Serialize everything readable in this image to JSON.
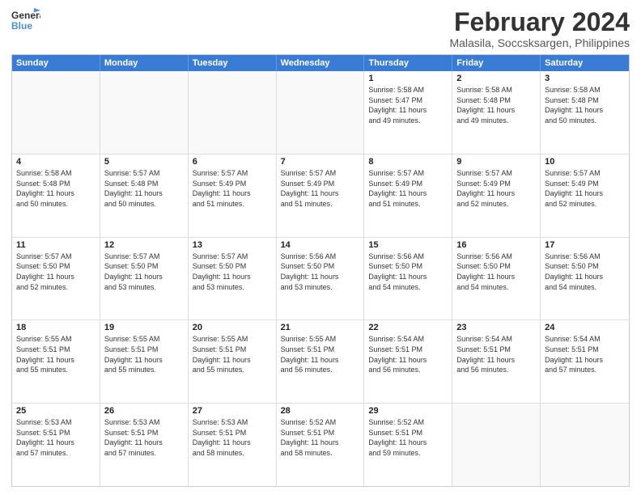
{
  "header": {
    "logo_line1": "General",
    "logo_line2": "Blue",
    "month": "February 2024",
    "location": "Malasila, Soccsksargen, Philippines"
  },
  "weekdays": [
    "Sunday",
    "Monday",
    "Tuesday",
    "Wednesday",
    "Thursday",
    "Friday",
    "Saturday"
  ],
  "rows": [
    [
      {
        "day": "",
        "info": "",
        "empty": true
      },
      {
        "day": "",
        "info": "",
        "empty": true
      },
      {
        "day": "",
        "info": "",
        "empty": true
      },
      {
        "day": "",
        "info": "",
        "empty": true
      },
      {
        "day": "1",
        "info": "Sunrise: 5:58 AM\nSunset: 5:47 PM\nDaylight: 11 hours\nand 49 minutes.",
        "empty": false
      },
      {
        "day": "2",
        "info": "Sunrise: 5:58 AM\nSunset: 5:48 PM\nDaylight: 11 hours\nand 49 minutes.",
        "empty": false
      },
      {
        "day": "3",
        "info": "Sunrise: 5:58 AM\nSunset: 5:48 PM\nDaylight: 11 hours\nand 50 minutes.",
        "empty": false
      }
    ],
    [
      {
        "day": "4",
        "info": "Sunrise: 5:58 AM\nSunset: 5:48 PM\nDaylight: 11 hours\nand 50 minutes.",
        "empty": false
      },
      {
        "day": "5",
        "info": "Sunrise: 5:57 AM\nSunset: 5:48 PM\nDaylight: 11 hours\nand 50 minutes.",
        "empty": false
      },
      {
        "day": "6",
        "info": "Sunrise: 5:57 AM\nSunset: 5:49 PM\nDaylight: 11 hours\nand 51 minutes.",
        "empty": false
      },
      {
        "day": "7",
        "info": "Sunrise: 5:57 AM\nSunset: 5:49 PM\nDaylight: 11 hours\nand 51 minutes.",
        "empty": false
      },
      {
        "day": "8",
        "info": "Sunrise: 5:57 AM\nSunset: 5:49 PM\nDaylight: 11 hours\nand 51 minutes.",
        "empty": false
      },
      {
        "day": "9",
        "info": "Sunrise: 5:57 AM\nSunset: 5:49 PM\nDaylight: 11 hours\nand 52 minutes.",
        "empty": false
      },
      {
        "day": "10",
        "info": "Sunrise: 5:57 AM\nSunset: 5:49 PM\nDaylight: 11 hours\nand 52 minutes.",
        "empty": false
      }
    ],
    [
      {
        "day": "11",
        "info": "Sunrise: 5:57 AM\nSunset: 5:50 PM\nDaylight: 11 hours\nand 52 minutes.",
        "empty": false
      },
      {
        "day": "12",
        "info": "Sunrise: 5:57 AM\nSunset: 5:50 PM\nDaylight: 11 hours\nand 53 minutes.",
        "empty": false
      },
      {
        "day": "13",
        "info": "Sunrise: 5:57 AM\nSunset: 5:50 PM\nDaylight: 11 hours\nand 53 minutes.",
        "empty": false
      },
      {
        "day": "14",
        "info": "Sunrise: 5:56 AM\nSunset: 5:50 PM\nDaylight: 11 hours\nand 53 minutes.",
        "empty": false
      },
      {
        "day": "15",
        "info": "Sunrise: 5:56 AM\nSunset: 5:50 PM\nDaylight: 11 hours\nand 54 minutes.",
        "empty": false
      },
      {
        "day": "16",
        "info": "Sunrise: 5:56 AM\nSunset: 5:50 PM\nDaylight: 11 hours\nand 54 minutes.",
        "empty": false
      },
      {
        "day": "17",
        "info": "Sunrise: 5:56 AM\nSunset: 5:50 PM\nDaylight: 11 hours\nand 54 minutes.",
        "empty": false
      }
    ],
    [
      {
        "day": "18",
        "info": "Sunrise: 5:55 AM\nSunset: 5:51 PM\nDaylight: 11 hours\nand 55 minutes.",
        "empty": false
      },
      {
        "day": "19",
        "info": "Sunrise: 5:55 AM\nSunset: 5:51 PM\nDaylight: 11 hours\nand 55 minutes.",
        "empty": false
      },
      {
        "day": "20",
        "info": "Sunrise: 5:55 AM\nSunset: 5:51 PM\nDaylight: 11 hours\nand 55 minutes.",
        "empty": false
      },
      {
        "day": "21",
        "info": "Sunrise: 5:55 AM\nSunset: 5:51 PM\nDaylight: 11 hours\nand 56 minutes.",
        "empty": false
      },
      {
        "day": "22",
        "info": "Sunrise: 5:54 AM\nSunset: 5:51 PM\nDaylight: 11 hours\nand 56 minutes.",
        "empty": false
      },
      {
        "day": "23",
        "info": "Sunrise: 5:54 AM\nSunset: 5:51 PM\nDaylight: 11 hours\nand 56 minutes.",
        "empty": false
      },
      {
        "day": "24",
        "info": "Sunrise: 5:54 AM\nSunset: 5:51 PM\nDaylight: 11 hours\nand 57 minutes.",
        "empty": false
      }
    ],
    [
      {
        "day": "25",
        "info": "Sunrise: 5:53 AM\nSunset: 5:51 PM\nDaylight: 11 hours\nand 57 minutes.",
        "empty": false
      },
      {
        "day": "26",
        "info": "Sunrise: 5:53 AM\nSunset: 5:51 PM\nDaylight: 11 hours\nand 57 minutes.",
        "empty": false
      },
      {
        "day": "27",
        "info": "Sunrise: 5:53 AM\nSunset: 5:51 PM\nDaylight: 11 hours\nand 58 minutes.",
        "empty": false
      },
      {
        "day": "28",
        "info": "Sunrise: 5:52 AM\nSunset: 5:51 PM\nDaylight: 11 hours\nand 58 minutes.",
        "empty": false
      },
      {
        "day": "29",
        "info": "Sunrise: 5:52 AM\nSunset: 5:51 PM\nDaylight: 11 hours\nand 59 minutes.",
        "empty": false
      },
      {
        "day": "",
        "info": "",
        "empty": true
      },
      {
        "day": "",
        "info": "",
        "empty": true
      }
    ]
  ]
}
